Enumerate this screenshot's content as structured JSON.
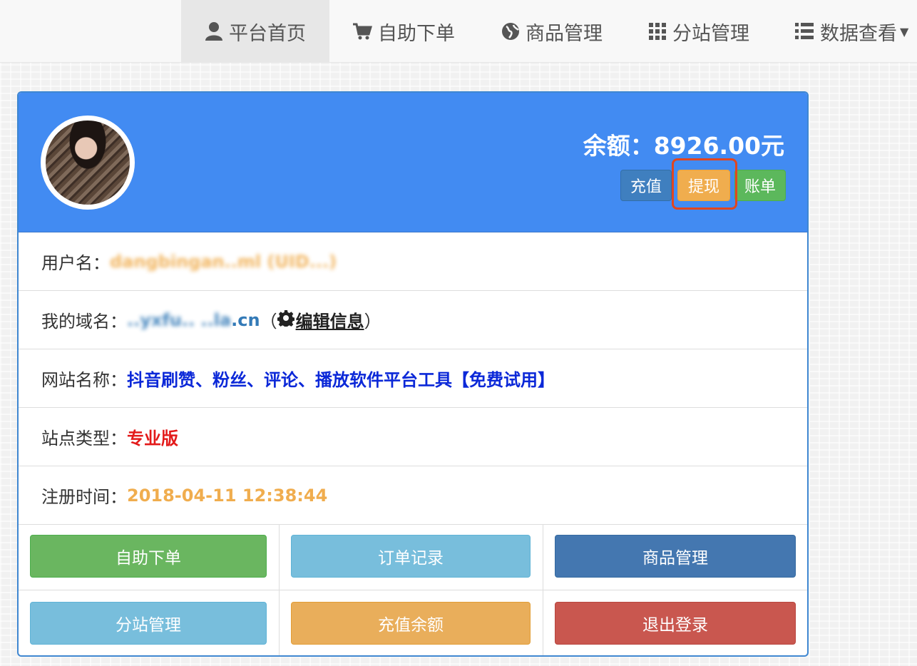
{
  "nav": {
    "items": [
      {
        "label": "平台首页",
        "icon": "user-icon",
        "active": true
      },
      {
        "label": "自助下单",
        "icon": "cart-icon"
      },
      {
        "label": "商品管理",
        "icon": "globe-icon"
      },
      {
        "label": "分站管理",
        "icon": "grid-icon"
      },
      {
        "label": "数据查看",
        "icon": "list-icon",
        "dropdown": true
      }
    ]
  },
  "header": {
    "balance_label": "余额：",
    "balance_value": "8926.00元",
    "buttons": {
      "recharge": "充值",
      "withdraw": "提现",
      "bill": "账单"
    },
    "colors": {
      "header_bg": "#428bf2",
      "highlight": "#e1461f"
    }
  },
  "info": {
    "username": {
      "label": "用户名：",
      "value": "dangbingan..ml (UID...)"
    },
    "domain": {
      "label": "我的域名：",
      "value_blurred": "..yxfu.. ..la",
      "value_suffix": ".cn",
      "paren_open": "（",
      "edit_label": "编辑信息",
      "paren_close": " ）"
    },
    "site_name": {
      "label": "网站名称：",
      "value": "抖音刷赞、粉丝、评论、播放软件平台工具【免费试用】"
    },
    "site_type": {
      "label": "站点类型：",
      "value": "专业版"
    },
    "register_time": {
      "label": "注册时间：",
      "value": "2018-04-11 12:38:44"
    }
  },
  "actions": {
    "self_order": "自助下单",
    "order_records": "订单记录",
    "goods_manage": "商品管理",
    "substation_manage": "分站管理",
    "recharge_balance": "充值余额",
    "logout": "退出登录"
  }
}
